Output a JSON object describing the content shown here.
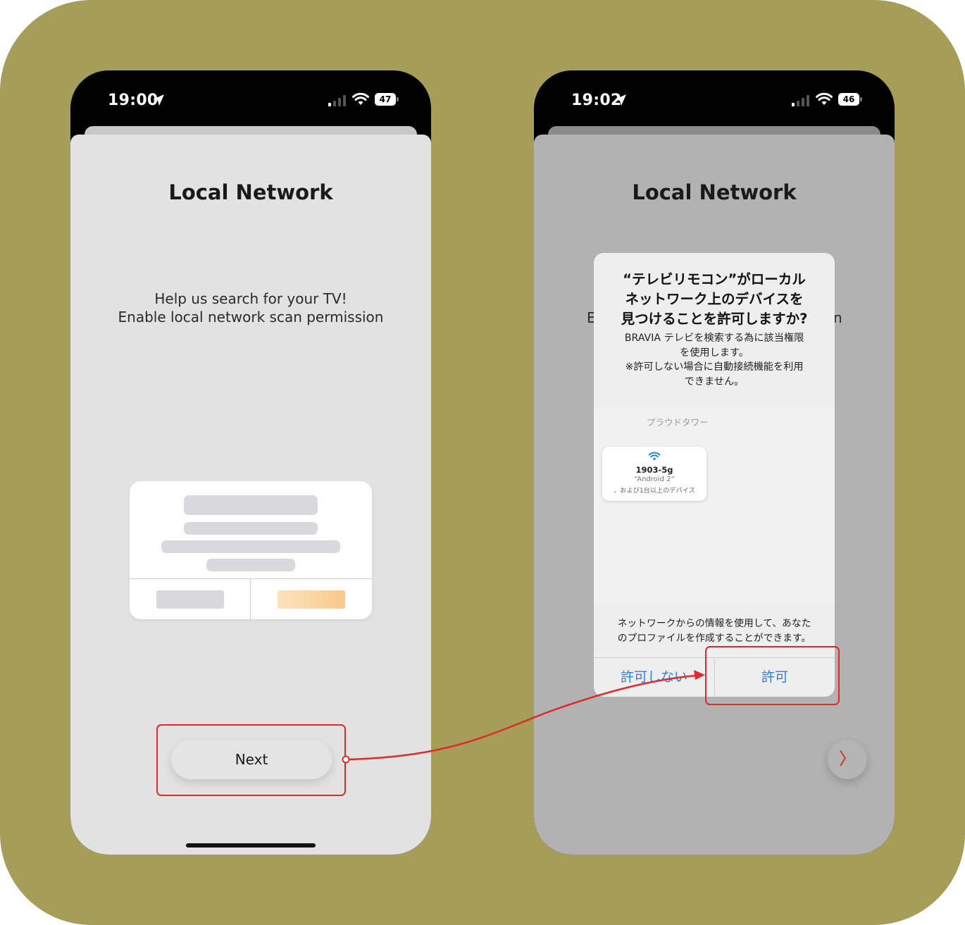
{
  "left_screen": {
    "status": {
      "time": "19:00",
      "battery": "47"
    },
    "title": "Local Network",
    "help_lines": [
      "Help us search for your TV!",
      "Enable local network scan permission"
    ],
    "next_label": "Next"
  },
  "right_screen": {
    "status": {
      "time": "19:02",
      "battery": "46"
    },
    "title": "Local Network",
    "peek_left": "E",
    "peek_right": "n",
    "chevron": "〉",
    "alert": {
      "title_lines": [
        "“テレビリモコン”がローカル",
        "ネットワーク上のデバイスを",
        "見つけることを許可しますか?"
      ],
      "message_lines": [
        "BRAVIA テレビを検索する為に該当権限",
        "を使用します。",
        "※許可しない場合に自動接続機能を利用",
        "できません。"
      ],
      "network_label": "プラウドタワー",
      "network_card": {
        "name": "1903-5g",
        "sub": "“Android 2”",
        "more": "、および1台以上のデバイス"
      },
      "footer_lines": [
        "ネットワークからの情報を使用して、あなた",
        "のプロファイルを作成することができます。"
      ],
      "deny_label": "許可しない",
      "allow_label": "許可"
    }
  },
  "colors": {
    "background": "#a59d58",
    "highlight": "#e02a2a",
    "link_blue": "#2f7fd8",
    "accent_orange": "#f8c98b"
  }
}
